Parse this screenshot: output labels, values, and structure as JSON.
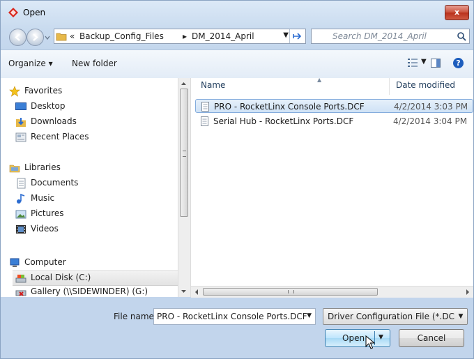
{
  "window": {
    "title": "Open",
    "close_label": "x"
  },
  "address_bar": {
    "parts": [
      "«",
      "Backup_Config_Files",
      "▸",
      "DM_2014_April"
    ],
    "search_placeholder": "Search DM_2014_April"
  },
  "toolbar": {
    "organize_label": "Organize ▾",
    "new_folder_label": "New folder",
    "help_label": "?"
  },
  "nav": {
    "favorites": "Favorites",
    "desktop": "Desktop",
    "downloads": "Downloads",
    "recent_places": "Recent Places",
    "libraries": "Libraries",
    "documents": "Documents",
    "music": "Music",
    "pictures": "Pictures",
    "videos": "Videos",
    "computer": "Computer",
    "local_disk": "Local Disk (C:)",
    "gallery": "Gallery (\\\\SIDEWINDER) (G:)"
  },
  "files": {
    "columns": {
      "name": "Name",
      "date": "Date modified"
    },
    "rows": [
      {
        "name": "PRO - RocketLinx Console Ports.DCF",
        "date": "4/2/2014 3:03 PM",
        "selected": true
      },
      {
        "name": "Serial Hub - RocketLinx Ports.DCF",
        "date": "4/2/2014 3:04 PM",
        "selected": false
      }
    ]
  },
  "bottom": {
    "filename_label": "File name:",
    "filename_value": "PRO - RocketLinx Console Ports.DCF",
    "filter_value": "Driver Configuration File (*.DCF",
    "open_label": "Open",
    "cancel_label": "Cancel"
  },
  "colors": {
    "accent": "#3c7fb1",
    "selection": "#cfe2f6",
    "title_close": "#c9503b"
  }
}
